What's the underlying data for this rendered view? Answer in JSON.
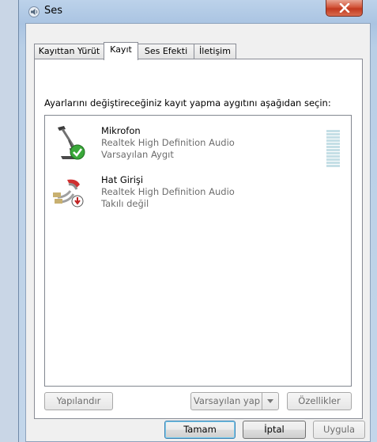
{
  "window": {
    "title": "Ses"
  },
  "tabs": [
    {
      "label": "Kayıttan Yürüt"
    },
    {
      "label": "Kayıt"
    },
    {
      "label": "Ses Efekti"
    },
    {
      "label": "İletişim"
    }
  ],
  "active_tab": "Kayıt",
  "instruction": "Ayarlarını değiştireceğiniz kayıt yapma aygıtını aşağıdan seçin:",
  "devices": [
    {
      "name": "Mikrofon",
      "driver": "Realtek High Definition Audio",
      "status": "Varsayılan Aygıt",
      "icon": "microphone-icon",
      "badge": "check-badge-icon"
    },
    {
      "name": "Hat Girişi",
      "driver": "Realtek High Definition Audio",
      "status": "Takılı değil",
      "icon": "line-in-cable-icon",
      "badge": "unplugged-badge-icon"
    }
  ],
  "panel_buttons": {
    "configure": "Yapılandır",
    "set_default": "Varsayılan yap",
    "properties": "Özellikler"
  },
  "dialog_buttons": {
    "ok": "Tamam",
    "cancel": "İptal",
    "apply": "Uygula"
  },
  "colors": {
    "close_button": "#c7432a",
    "selection_check": "#3aa83a",
    "meter": "#c5dfe6"
  }
}
